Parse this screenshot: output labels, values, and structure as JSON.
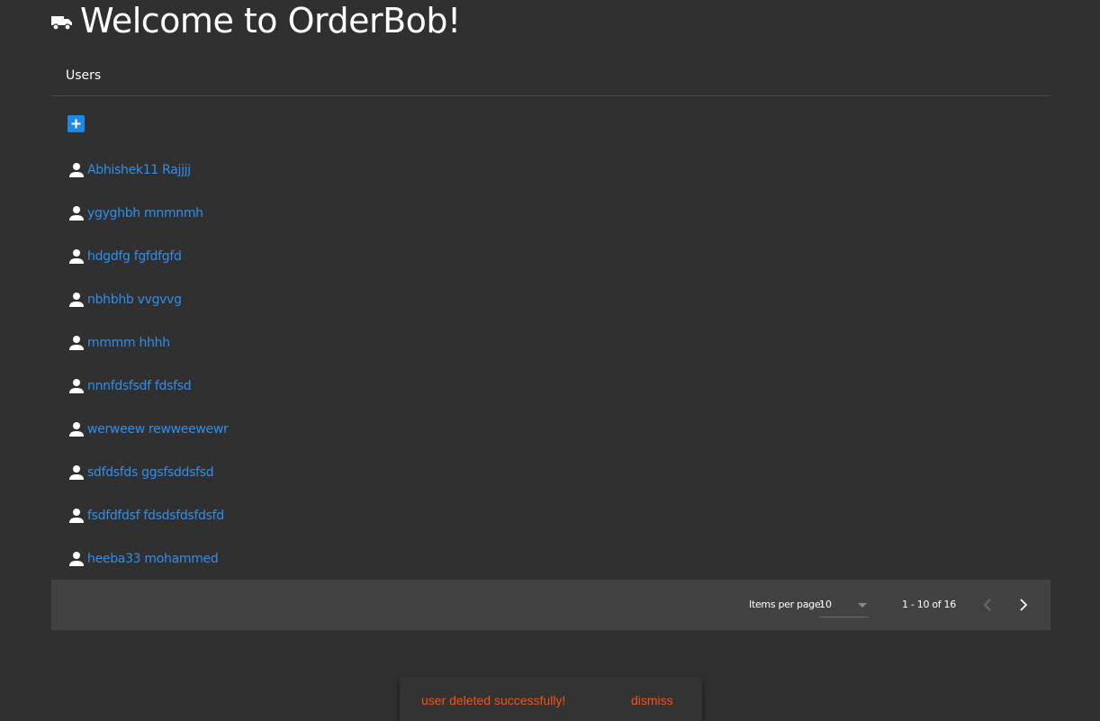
{
  "header": {
    "icon": "truck-icon",
    "title": "Welcome to OrderBob!"
  },
  "users_panel": {
    "title": "Users",
    "add_icon": "add-box-icon",
    "user_icon": "person-icon",
    "users": [
      {
        "name": "Abhishek11 Rajjjj"
      },
      {
        "name": "ygyghbh mnmnmh"
      },
      {
        "name": "hdgdfg fgfdfgfd"
      },
      {
        "name": "nbhbhb vvgvvg"
      },
      {
        "name": "mmmm hhhh"
      },
      {
        "name": "nnnfdsfsdf fdsfsd"
      },
      {
        "name": "werweew rewweewewr"
      },
      {
        "name": "sdfdsfds ggsfsddsfsd"
      },
      {
        "name": "fsdfdfdsf fdsdsfdsfdsfd"
      },
      {
        "name": "heeba33 mohammed"
      }
    ]
  },
  "paginator": {
    "items_per_page_label": "Items per page:",
    "items_per_page_value": "10",
    "range_label": "1 - 10 of 16",
    "prev_icon": "chevron-left-icon",
    "next_icon": "chevron-right-icon"
  },
  "snackbar": {
    "message": "user deleted successfully!",
    "action": "dismiss"
  },
  "colors": {
    "background": "#303030",
    "paginator_background": "#424242",
    "link": "#2d8ff0",
    "accent": "#1e88e5",
    "snackbar_text": "#f4511e"
  }
}
